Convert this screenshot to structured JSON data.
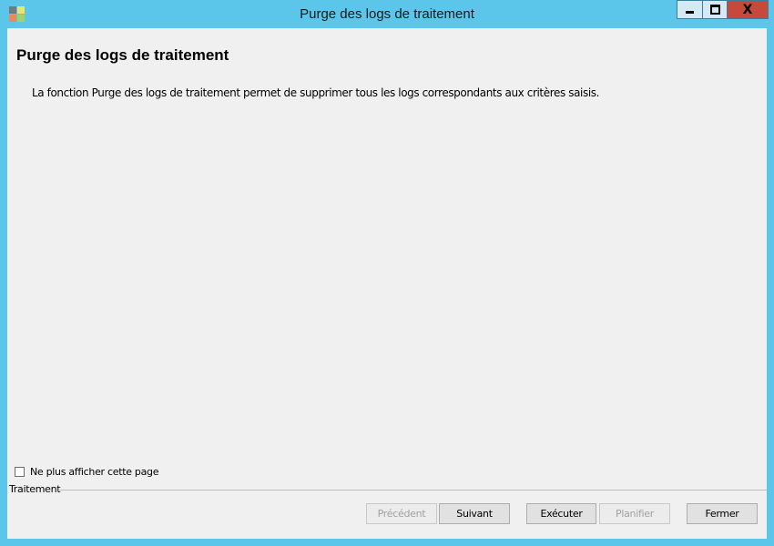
{
  "window": {
    "title": "Purge des logs de traitement",
    "close_glyph": "X",
    "colors": {
      "frame": "#5bc5ea",
      "close": "#c8483b",
      "client": "#f0f0f0"
    }
  },
  "page": {
    "heading": "Purge des logs de traitement",
    "description": "La fonction Purge des logs de traitement permet de supprimer tous les logs correspondants aux critères saisis."
  },
  "options": {
    "dont_show_label": "Ne plus afficher cette page",
    "dont_show_checked": false
  },
  "group": {
    "label": "Traitement"
  },
  "buttons": {
    "previous": "Précédent",
    "next": "Suivant",
    "execute": "Exécuter",
    "schedule": "Planifier",
    "close": "Fermer"
  }
}
